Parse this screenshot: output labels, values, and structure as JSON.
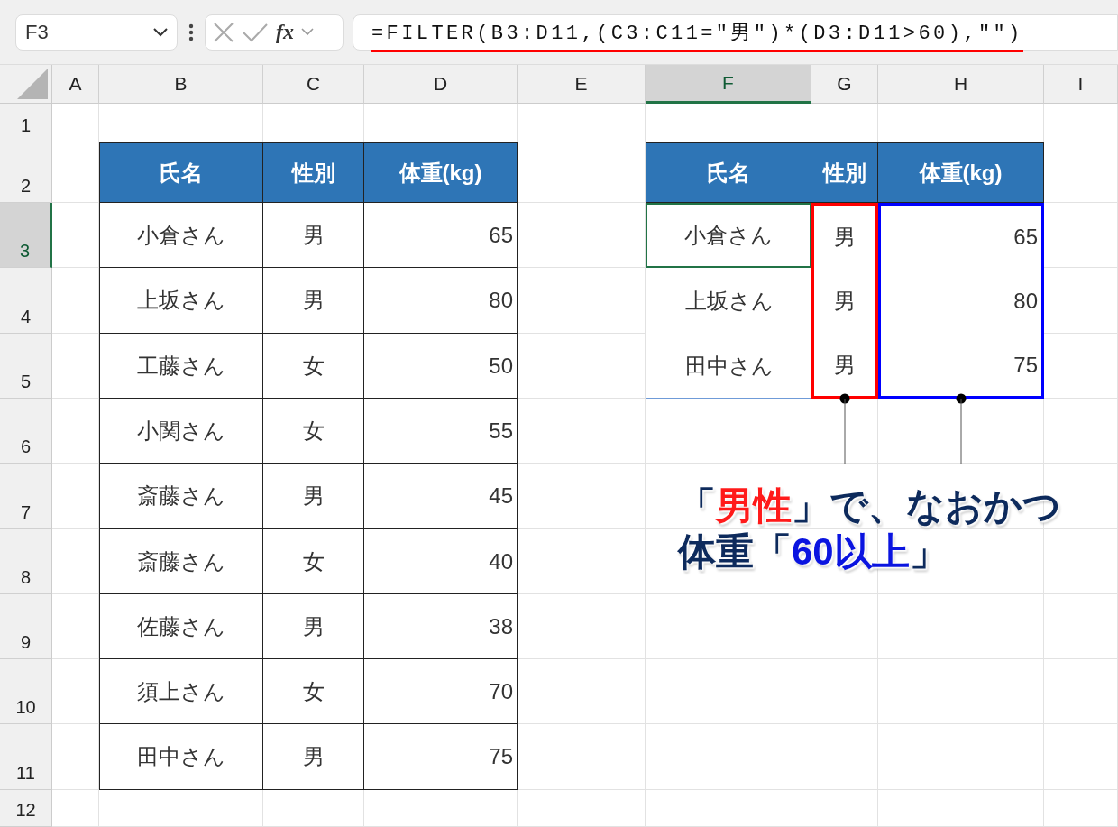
{
  "name_box": {
    "value": "F3"
  },
  "fx_label": "fx",
  "formula": "=FILTER(B3:D11,(C3:C11=\"男\")*(D3:D11>60),\"\")",
  "columns": [
    {
      "label": "A",
      "selected": false
    },
    {
      "label": "B",
      "selected": false
    },
    {
      "label": "C",
      "selected": false
    },
    {
      "label": "D",
      "selected": false
    },
    {
      "label": "E",
      "selected": false
    },
    {
      "label": "F",
      "selected": true
    },
    {
      "label": "G",
      "selected": false
    },
    {
      "label": "H",
      "selected": false
    },
    {
      "label": "I",
      "selected": false
    }
  ],
  "rows": [
    {
      "label": "1",
      "selected": false
    },
    {
      "label": "2",
      "selected": false
    },
    {
      "label": "3",
      "selected": true
    },
    {
      "label": "4",
      "selected": false
    },
    {
      "label": "5",
      "selected": false
    },
    {
      "label": "6",
      "selected": false
    },
    {
      "label": "7",
      "selected": false
    },
    {
      "label": "8",
      "selected": false
    },
    {
      "label": "9",
      "selected": false
    },
    {
      "label": "10",
      "selected": false
    },
    {
      "label": "11",
      "selected": false
    },
    {
      "label": "12",
      "selected": false
    }
  ],
  "source_table": {
    "headers": [
      "氏名",
      "性別",
      "体重(kg)"
    ],
    "rows": [
      [
        "小倉さん",
        "男",
        "65"
      ],
      [
        "上坂さん",
        "男",
        "80"
      ],
      [
        "工藤さん",
        "女",
        "50"
      ],
      [
        "小関さん",
        "女",
        "55"
      ],
      [
        "斎藤さん",
        "男",
        "45"
      ],
      [
        "斎藤さん",
        "女",
        "40"
      ],
      [
        "佐藤さん",
        "男",
        "38"
      ],
      [
        "須上さん",
        "女",
        "70"
      ],
      [
        "田中さん",
        "男",
        "75"
      ]
    ]
  },
  "result_table": {
    "headers": [
      "氏名",
      "性別",
      "体重(kg)"
    ],
    "rows": [
      [
        "小倉さん",
        "男",
        "65"
      ],
      [
        "上坂さん",
        "男",
        "80"
      ],
      [
        "田中さん",
        "男",
        "75"
      ]
    ]
  },
  "callout": {
    "lines": [
      [
        {
          "text": "「",
          "color": "#0d2a5c"
        },
        {
          "text": "男性",
          "color": "#ff1a1a"
        },
        {
          "text": "」で、なおかつ",
          "color": "#0d2a5c"
        }
      ],
      [
        {
          "text": "体重「",
          "color": "#0d2a5c"
        },
        {
          "text": "60以上",
          "color": "#0a14e0"
        },
        {
          "text": "」",
          "color": "#0d2a5c"
        }
      ]
    ]
  }
}
